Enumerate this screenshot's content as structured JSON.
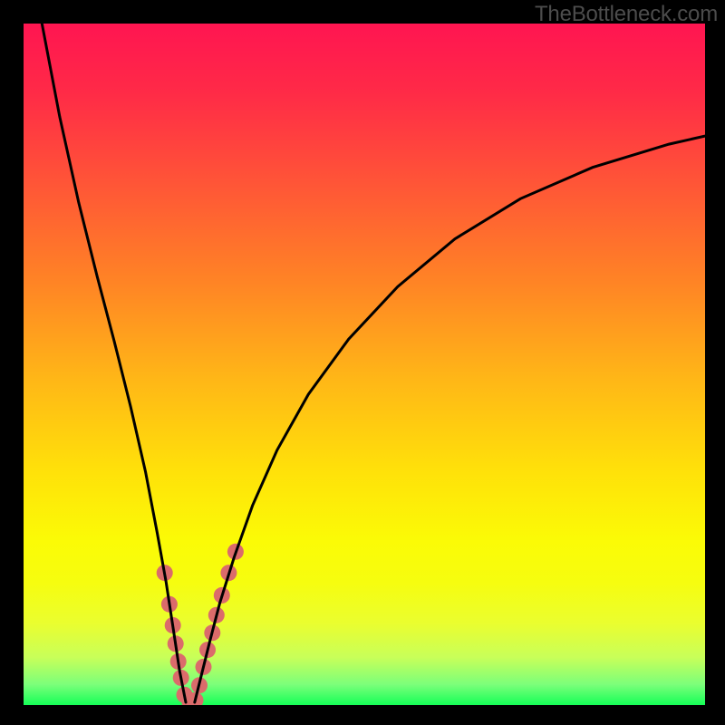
{
  "watermark": "TheBottleneck.com",
  "chart_data": {
    "type": "line",
    "title": "",
    "xlabel": "",
    "ylabel": "",
    "xlim": [
      0,
      100
    ],
    "ylim": [
      0,
      100
    ],
    "grid": false,
    "left_curve": {
      "name": "left-curve",
      "points": [
        {
          "x": 2.7,
          "y": 100.0
        },
        {
          "x": 5.3,
          "y": 86.3
        },
        {
          "x": 8.1,
          "y": 73.7
        },
        {
          "x": 10.8,
          "y": 62.9
        },
        {
          "x": 13.3,
          "y": 53.4
        },
        {
          "x": 15.7,
          "y": 43.8
        },
        {
          "x": 17.9,
          "y": 34.2
        },
        {
          "x": 19.6,
          "y": 25.3
        },
        {
          "x": 20.9,
          "y": 18.1
        },
        {
          "x": 22.0,
          "y": 11.0
        },
        {
          "x": 22.9,
          "y": 5.0
        },
        {
          "x": 23.8,
          "y": 0.4
        }
      ]
    },
    "right_curve": {
      "name": "right-curve",
      "points": [
        {
          "x": 25.1,
          "y": 0.4
        },
        {
          "x": 26.2,
          "y": 4.8
        },
        {
          "x": 27.4,
          "y": 9.6
        },
        {
          "x": 28.8,
          "y": 15.0
        },
        {
          "x": 30.9,
          "y": 21.7
        },
        {
          "x": 33.6,
          "y": 29.3
        },
        {
          "x": 37.2,
          "y": 37.4
        },
        {
          "x": 41.8,
          "y": 45.6
        },
        {
          "x": 47.7,
          "y": 53.7
        },
        {
          "x": 54.9,
          "y": 61.4
        },
        {
          "x": 63.3,
          "y": 68.4
        },
        {
          "x": 72.9,
          "y": 74.3
        },
        {
          "x": 83.5,
          "y": 78.9
        },
        {
          "x": 94.7,
          "y": 82.3
        },
        {
          "x": 100.0,
          "y": 83.5
        }
      ]
    },
    "highlight_markers": {
      "color": "#db6b6b",
      "radius_px": 9,
      "points": [
        {
          "x": 20.7,
          "y": 19.4
        },
        {
          "x": 21.4,
          "y": 14.8
        },
        {
          "x": 21.9,
          "y": 11.7
        },
        {
          "x": 22.3,
          "y": 9.0
        },
        {
          "x": 22.7,
          "y": 6.4
        },
        {
          "x": 23.1,
          "y": 4.0
        },
        {
          "x": 23.6,
          "y": 1.5
        },
        {
          "x": 24.4,
          "y": 0.4
        },
        {
          "x": 25.2,
          "y": 0.7
        },
        {
          "x": 25.8,
          "y": 2.9
        },
        {
          "x": 26.4,
          "y": 5.6
        },
        {
          "x": 27.0,
          "y": 8.1
        },
        {
          "x": 27.7,
          "y": 10.6
        },
        {
          "x": 28.3,
          "y": 13.2
        },
        {
          "x": 29.1,
          "y": 16.1
        },
        {
          "x": 30.1,
          "y": 19.4
        },
        {
          "x": 31.1,
          "y": 22.5
        }
      ]
    }
  }
}
